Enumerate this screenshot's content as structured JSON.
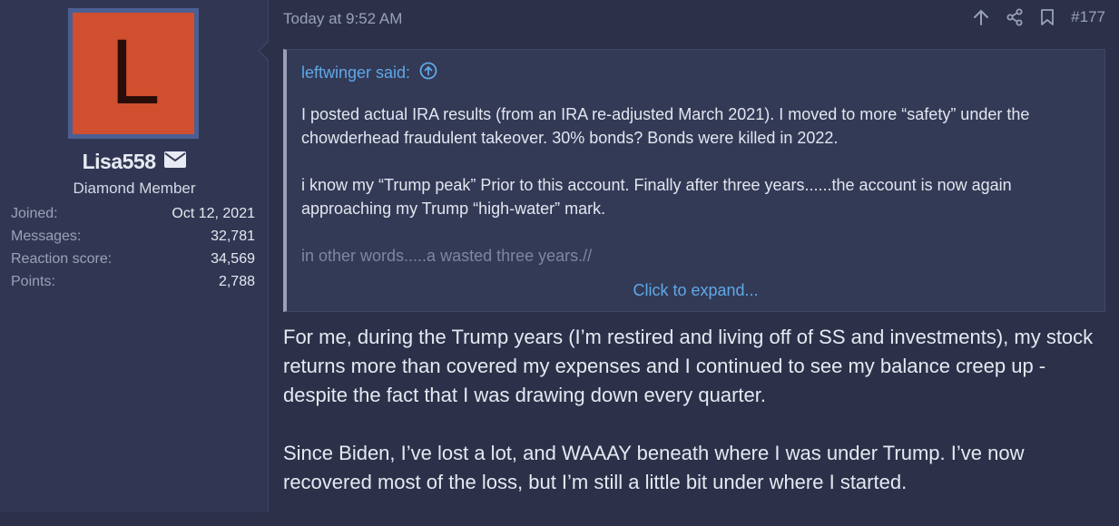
{
  "user": {
    "avatar_letter": "L",
    "username": "Lisa558",
    "title": "Diamond Member",
    "stats": [
      {
        "label": "Joined:",
        "value": "Oct 12, 2021"
      },
      {
        "label": "Messages:",
        "value": "32,781"
      },
      {
        "label": "Reaction score:",
        "value": "34,569"
      },
      {
        "label": "Points:",
        "value": "2,788"
      }
    ]
  },
  "post": {
    "date": "Today at 9:52 AM",
    "number": "#177",
    "icons": [
      "arrow-up-icon",
      "share-icon",
      "bookmark-icon"
    ],
    "quote": {
      "author": "leftwinger said:",
      "paragraphs": [
        "I posted actual IRA results (from an IRA re-adjusted March 2021). I moved to more “safety” under the chowderhead fraudulent takeover. 30% bonds? Bonds were killed in 2022.",
        "i know my “Trump peak” Prior to this account. Finally after three years......the account is now again approaching my Trump “high-water” mark.",
        "in other words.....a wasted three years.//"
      ],
      "expand_label": "Click to expand..."
    },
    "body": [
      "For me, during the Trump years (I’m restired and living off of SS and investments), my stock returns more than covered my expenses and I continued to see my balance creep up - despite the fact that I was drawing down every quarter.",
      "Since Biden, I’ve lost a lot, and WAAAY beneath where I was under Trump. I’ve now recovered most of the loss, but I’m still a little bit under where I started."
    ]
  },
  "colors": {
    "background": "#2c3149",
    "sidebar": "#313753",
    "avatar_bg": "#cf4f2f",
    "link": "#5fa8e8"
  }
}
